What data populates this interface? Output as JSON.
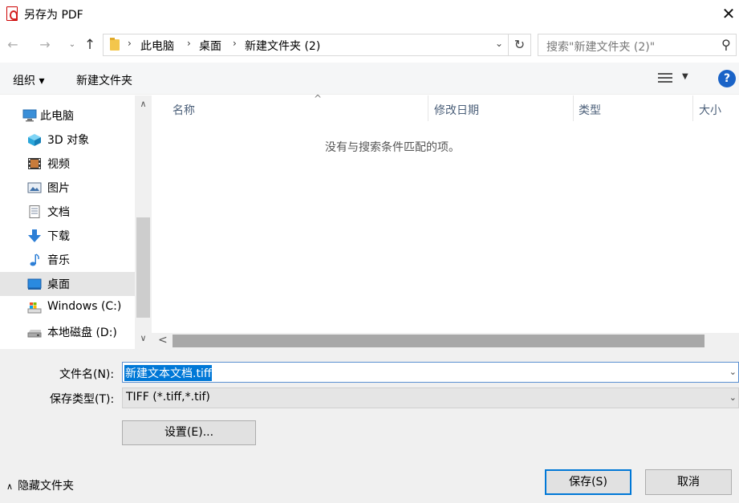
{
  "window": {
    "title": "另存为 PDF",
    "close_glyph": "✕"
  },
  "nav": {
    "back_glyph": "←",
    "forward_glyph": "→",
    "recent_glyph": "⌄",
    "up_glyph": "↑",
    "breadcrumbs": [
      "此电脑",
      "桌面",
      "新建文件夹 (2)"
    ],
    "separator": "›",
    "address_dropdown_glyph": "⌄",
    "refresh_glyph": "↻",
    "search_placeholder": "搜索\"新建文件夹 (2)\"",
    "search_glyph": "⚲"
  },
  "toolbar": {
    "organize_label": "组织 ▾",
    "new_folder_label": "新建文件夹",
    "view_drop_glyph": "▼",
    "help_glyph": "?"
  },
  "sidebar": {
    "items": [
      {
        "label": "此电脑",
        "icon": "computer-icon"
      },
      {
        "label": "3D 对象",
        "icon": "cube-3d-icon"
      },
      {
        "label": "视频",
        "icon": "film-icon"
      },
      {
        "label": "图片",
        "icon": "picture-icon"
      },
      {
        "label": "文档",
        "icon": "document-icon"
      },
      {
        "label": "下载",
        "icon": "download-arrow-icon"
      },
      {
        "label": "音乐",
        "icon": "music-note-icon"
      },
      {
        "label": "桌面",
        "icon": "desktop-icon",
        "selected": true
      },
      {
        "label": "Windows (C:)",
        "icon": "windows-drive-icon"
      },
      {
        "label": "本地磁盘 (D:)",
        "icon": "hard-drive-icon"
      }
    ],
    "scroll_up_glyph": "∧",
    "scroll_down_glyph": "∨"
  },
  "filelist": {
    "columns": [
      "名称",
      "修改日期",
      "类型",
      "大小"
    ],
    "sort_glyph": "^",
    "empty_message": "没有与搜索条件匹配的项。",
    "scroll_left_glyph": "<"
  },
  "form": {
    "filename_label": "文件名(N):",
    "filename_value": "新建文本文档.tiff",
    "type_label": "保存类型(T):",
    "type_value": "TIFF (*.tiff,*.tif)",
    "dropdown_glyph": "⌄",
    "settings_label": "设置(E)..."
  },
  "footer": {
    "hide_arrow_glyph": "∧",
    "hide_folders_label": "隐藏文件夹",
    "save_label": "保存(S)",
    "cancel_label": "取消"
  },
  "colors": {
    "accent": "#0078d7",
    "selected_bg": "#e5e5e5",
    "lower_bg": "#f0f0f0",
    "column_header_text": "#4c607a"
  }
}
